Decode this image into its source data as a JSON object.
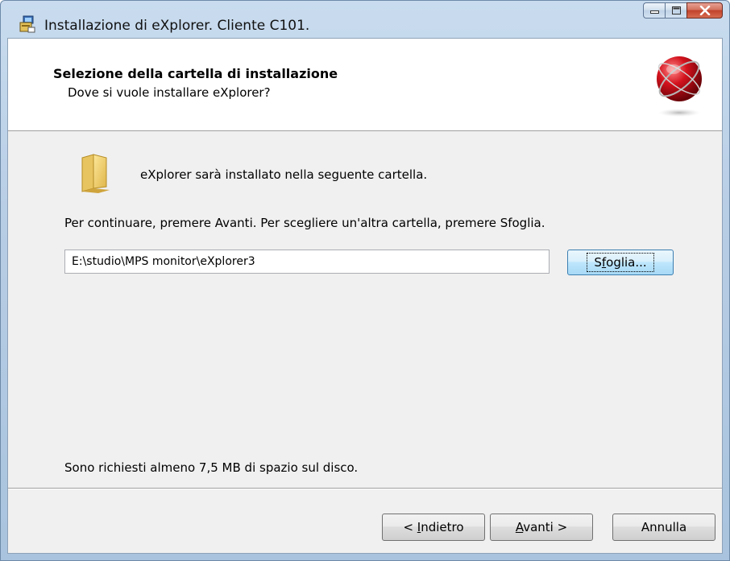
{
  "window": {
    "title": "Installazione di eXplorer. Cliente C101."
  },
  "header": {
    "title": "Selezione della cartella di installazione",
    "subtitle": "Dove si vuole installare eXplorer?"
  },
  "body": {
    "folder_message": "eXplorer sarà installato nella seguente cartella.",
    "instruction": "Per continuare, premere Avanti. Per scegliere un'altra cartella, premere Sfoglia.",
    "path_value": "E:\\studio\\MPS monitor\\eXplorer3",
    "browse_button": {
      "pre": "S",
      "accel": "f",
      "post": "oglia..."
    },
    "disk_space": "Sono richiesti almeno 7,5 MB di spazio sul disco."
  },
  "footer": {
    "back_button": {
      "pre": "< ",
      "accel": "I",
      "post": "ndietro"
    },
    "next_button": {
      "pre": "",
      "accel": "A",
      "post": "vanti >"
    },
    "cancel_button": "Annulla"
  },
  "icons": {
    "app": "setup-icon",
    "minimize": "minimize-icon",
    "maximize": "maximize-icon",
    "close": "close-icon",
    "logo": "sphere-logo-icon",
    "folder": "folder-icon"
  },
  "colors": {
    "titlebar": "#b7cde4",
    "close_button": "#c1422b",
    "logo_red": "#c8121c"
  }
}
